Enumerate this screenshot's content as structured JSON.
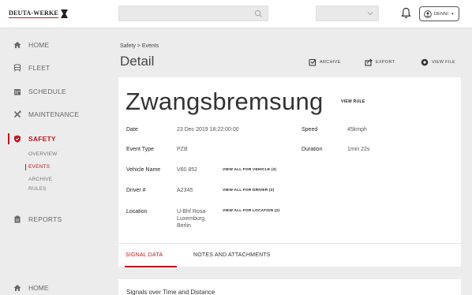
{
  "brand": {
    "logo_text": "DEUTA-WERKE"
  },
  "topbar": {
    "user_name": "DENNI",
    "user_chevron": "▾"
  },
  "sidebar": {
    "items": [
      {
        "label": "HOME",
        "icon": "home-icon"
      },
      {
        "label": "FLEET",
        "icon": "train-icon"
      },
      {
        "label": "SCHEDULE",
        "icon": "calendar-icon"
      },
      {
        "label": "MAINTENANCE",
        "icon": "tools-icon"
      },
      {
        "label": "SAFETY",
        "icon": "shield-icon",
        "active": true
      },
      {
        "label": "REPORTS",
        "icon": "clipboard-icon"
      }
    ],
    "safety_sub": [
      "OVERVIEW",
      "EVENTS",
      "ARCHIVE",
      "RULES"
    ],
    "bottom_item": {
      "label": "HOME",
      "icon": "home-icon"
    }
  },
  "header": {
    "breadcrumb": "Safety > Events",
    "title": "Detail",
    "actions": {
      "archive": "ARCHIVE",
      "export": "EXPORT",
      "view_file": "VIEW FILE"
    }
  },
  "event": {
    "title": "Zwangsbremsung",
    "view_rule": "VIEW RULE",
    "fields": {
      "date": {
        "label": "Date",
        "value": "23 Dec 2019 18:22:00:00"
      },
      "event_type": {
        "label": "Event Type",
        "value": "PZB"
      },
      "vehicle": {
        "label": "Vehicle Name",
        "value": "V60 852",
        "link": "VIEW ALL FOR VEHICLE (3)"
      },
      "driver": {
        "label": "Driver #",
        "value": "A2345",
        "link": "VIEW ALL FOR DRIVER (2)"
      },
      "location": {
        "label": "Location",
        "value": "U-Bhf Rosa-\nLuxemburg,\nBerlin",
        "link": "VIEW ALL FOR LOCATION (2)"
      },
      "speed": {
        "label": "Speed",
        "value": "45kmph"
      },
      "duration": {
        "label": "Duration",
        "value": "1min 22s"
      }
    }
  },
  "tabs": {
    "signal_data": "SIGNAL DATA",
    "notes": "NOTES AND ATTACHMENTS"
  },
  "signals": {
    "title": "Signals over Time and Distance"
  },
  "colors": {
    "accent": "#c0161d",
    "background": "#ececec",
    "card": "#ffffff"
  }
}
